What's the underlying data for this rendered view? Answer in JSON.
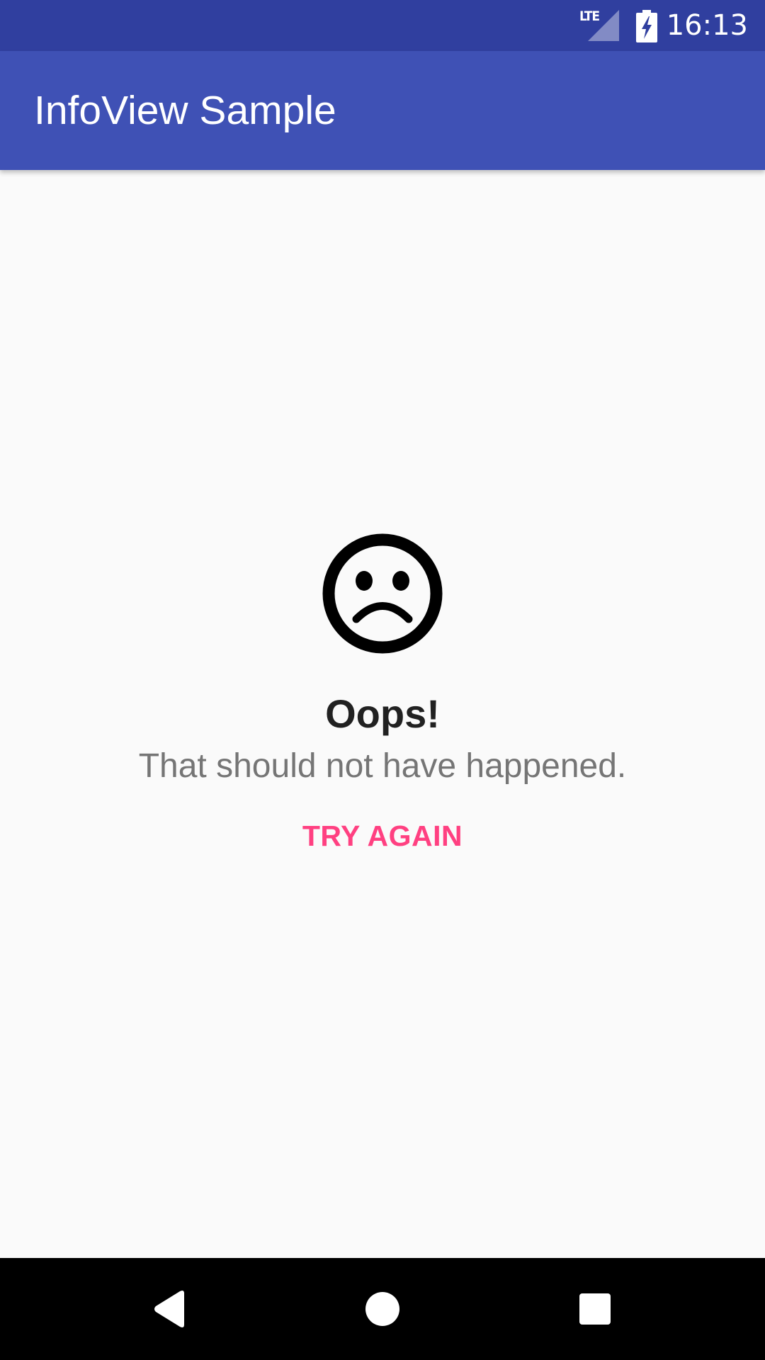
{
  "status_bar": {
    "time": "16:13",
    "network_type": "LTE",
    "signal_icon": "cell-signal-icon",
    "battery_icon": "battery-charging-icon",
    "color": "#303f9f"
  },
  "app_bar": {
    "title": "InfoView Sample",
    "color": "#3f51b5"
  },
  "info_view": {
    "icon": "sad-face-icon",
    "title": "Oops!",
    "message": "That should not have happened.",
    "action_label": "TRY AGAIN",
    "action_color": "#ff4081"
  },
  "nav_bar": {
    "back_icon": "back-icon",
    "home_icon": "home-icon",
    "recents_icon": "recents-icon"
  }
}
